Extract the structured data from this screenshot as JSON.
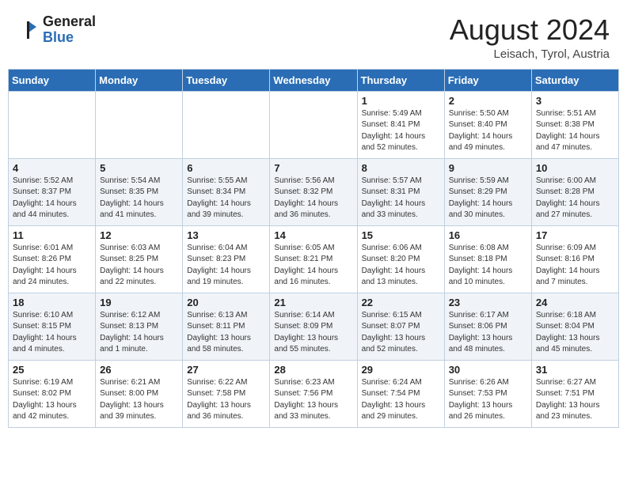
{
  "header": {
    "logo_general": "General",
    "logo_blue": "Blue",
    "month": "August 2024",
    "location": "Leisach, Tyrol, Austria"
  },
  "days_of_week": [
    "Sunday",
    "Monday",
    "Tuesday",
    "Wednesday",
    "Thursday",
    "Friday",
    "Saturday"
  ],
  "weeks": [
    [
      {
        "day": "",
        "info": ""
      },
      {
        "day": "",
        "info": ""
      },
      {
        "day": "",
        "info": ""
      },
      {
        "day": "",
        "info": ""
      },
      {
        "day": "1",
        "info": "Sunrise: 5:49 AM\nSunset: 8:41 PM\nDaylight: 14 hours\nand 52 minutes."
      },
      {
        "day": "2",
        "info": "Sunrise: 5:50 AM\nSunset: 8:40 PM\nDaylight: 14 hours\nand 49 minutes."
      },
      {
        "day": "3",
        "info": "Sunrise: 5:51 AM\nSunset: 8:38 PM\nDaylight: 14 hours\nand 47 minutes."
      }
    ],
    [
      {
        "day": "4",
        "info": "Sunrise: 5:52 AM\nSunset: 8:37 PM\nDaylight: 14 hours\nand 44 minutes."
      },
      {
        "day": "5",
        "info": "Sunrise: 5:54 AM\nSunset: 8:35 PM\nDaylight: 14 hours\nand 41 minutes."
      },
      {
        "day": "6",
        "info": "Sunrise: 5:55 AM\nSunset: 8:34 PM\nDaylight: 14 hours\nand 39 minutes."
      },
      {
        "day": "7",
        "info": "Sunrise: 5:56 AM\nSunset: 8:32 PM\nDaylight: 14 hours\nand 36 minutes."
      },
      {
        "day": "8",
        "info": "Sunrise: 5:57 AM\nSunset: 8:31 PM\nDaylight: 14 hours\nand 33 minutes."
      },
      {
        "day": "9",
        "info": "Sunrise: 5:59 AM\nSunset: 8:29 PM\nDaylight: 14 hours\nand 30 minutes."
      },
      {
        "day": "10",
        "info": "Sunrise: 6:00 AM\nSunset: 8:28 PM\nDaylight: 14 hours\nand 27 minutes."
      }
    ],
    [
      {
        "day": "11",
        "info": "Sunrise: 6:01 AM\nSunset: 8:26 PM\nDaylight: 14 hours\nand 24 minutes."
      },
      {
        "day": "12",
        "info": "Sunrise: 6:03 AM\nSunset: 8:25 PM\nDaylight: 14 hours\nand 22 minutes."
      },
      {
        "day": "13",
        "info": "Sunrise: 6:04 AM\nSunset: 8:23 PM\nDaylight: 14 hours\nand 19 minutes."
      },
      {
        "day": "14",
        "info": "Sunrise: 6:05 AM\nSunset: 8:21 PM\nDaylight: 14 hours\nand 16 minutes."
      },
      {
        "day": "15",
        "info": "Sunrise: 6:06 AM\nSunset: 8:20 PM\nDaylight: 14 hours\nand 13 minutes."
      },
      {
        "day": "16",
        "info": "Sunrise: 6:08 AM\nSunset: 8:18 PM\nDaylight: 14 hours\nand 10 minutes."
      },
      {
        "day": "17",
        "info": "Sunrise: 6:09 AM\nSunset: 8:16 PM\nDaylight: 14 hours\nand 7 minutes."
      }
    ],
    [
      {
        "day": "18",
        "info": "Sunrise: 6:10 AM\nSunset: 8:15 PM\nDaylight: 14 hours\nand 4 minutes."
      },
      {
        "day": "19",
        "info": "Sunrise: 6:12 AM\nSunset: 8:13 PM\nDaylight: 14 hours\nand 1 minute."
      },
      {
        "day": "20",
        "info": "Sunrise: 6:13 AM\nSunset: 8:11 PM\nDaylight: 13 hours\nand 58 minutes."
      },
      {
        "day": "21",
        "info": "Sunrise: 6:14 AM\nSunset: 8:09 PM\nDaylight: 13 hours\nand 55 minutes."
      },
      {
        "day": "22",
        "info": "Sunrise: 6:15 AM\nSunset: 8:07 PM\nDaylight: 13 hours\nand 52 minutes."
      },
      {
        "day": "23",
        "info": "Sunrise: 6:17 AM\nSunset: 8:06 PM\nDaylight: 13 hours\nand 48 minutes."
      },
      {
        "day": "24",
        "info": "Sunrise: 6:18 AM\nSunset: 8:04 PM\nDaylight: 13 hours\nand 45 minutes."
      }
    ],
    [
      {
        "day": "25",
        "info": "Sunrise: 6:19 AM\nSunset: 8:02 PM\nDaylight: 13 hours\nand 42 minutes."
      },
      {
        "day": "26",
        "info": "Sunrise: 6:21 AM\nSunset: 8:00 PM\nDaylight: 13 hours\nand 39 minutes."
      },
      {
        "day": "27",
        "info": "Sunrise: 6:22 AM\nSunset: 7:58 PM\nDaylight: 13 hours\nand 36 minutes."
      },
      {
        "day": "28",
        "info": "Sunrise: 6:23 AM\nSunset: 7:56 PM\nDaylight: 13 hours\nand 33 minutes."
      },
      {
        "day": "29",
        "info": "Sunrise: 6:24 AM\nSunset: 7:54 PM\nDaylight: 13 hours\nand 29 minutes."
      },
      {
        "day": "30",
        "info": "Sunrise: 6:26 AM\nSunset: 7:53 PM\nDaylight: 13 hours\nand 26 minutes."
      },
      {
        "day": "31",
        "info": "Sunrise: 6:27 AM\nSunset: 7:51 PM\nDaylight: 13 hours\nand 23 minutes."
      }
    ]
  ]
}
